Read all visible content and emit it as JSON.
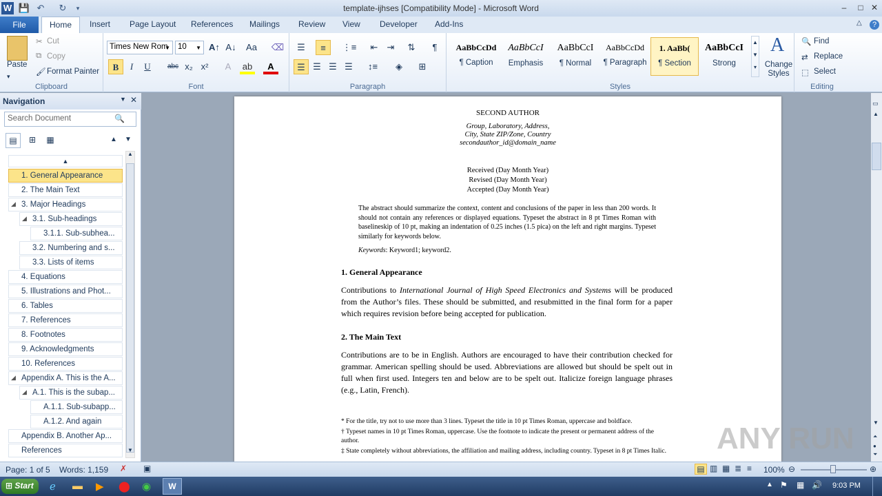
{
  "window": {
    "title": "template-ijhses [Compatibility Mode]  -  Microsoft Word",
    "minimize": "–",
    "maximize": "□",
    "close": "✕"
  },
  "tabs": [
    "File",
    "Home",
    "Insert",
    "Page Layout",
    "References",
    "Mailings",
    "Review",
    "View",
    "Developer",
    "Add-Ins"
  ],
  "ribbon": {
    "clipboard": {
      "paste": "Paste",
      "cut": "Cut",
      "copy": "Copy",
      "format_painter": "Format Painter",
      "label": "Clipboard"
    },
    "font": {
      "family": "Times New Rom",
      "size": "10",
      "label": "Font",
      "bold": "B",
      "italic": "I",
      "underline": "U",
      "strike": "abc",
      "sub": "x₂",
      "sup": "x²"
    },
    "paragraph": {
      "label": "Paragraph"
    },
    "styles": {
      "label": "Styles",
      "items": [
        {
          "preview": "AaBbCcDd",
          "name": "¶ Caption"
        },
        {
          "preview": "AaBbCcI",
          "name": "Emphasis"
        },
        {
          "preview": "AaBbCcI",
          "name": "¶ Normal"
        },
        {
          "preview": "AaBbCcDd",
          "name": "¶ Paragraph"
        },
        {
          "preview": "1.  AaBb(",
          "name": "¶ Section"
        },
        {
          "preview": "AaBbCcI",
          "name": "Strong"
        }
      ],
      "change_styles": "Change Styles"
    },
    "editing": {
      "label": "Editing",
      "find": "Find",
      "replace": "Replace",
      "select": "Select"
    }
  },
  "nav": {
    "title": "Navigation",
    "search_placeholder": "Search Document",
    "items": [
      {
        "label": "1.     General Appearance",
        "indent": 0,
        "selected": true
      },
      {
        "label": "2.     The Main Text",
        "indent": 0
      },
      {
        "label": "3.     Major Headings",
        "indent": 0,
        "tri": true
      },
      {
        "label": "3.1.     Sub-headings",
        "indent": 1,
        "tri": true
      },
      {
        "label": "3.1.1.     Sub-subhea...",
        "indent": 2
      },
      {
        "label": "3.2.     Numbering and s...",
        "indent": 1
      },
      {
        "label": "3.3.     Lists of items",
        "indent": 1
      },
      {
        "label": "4.     Equations",
        "indent": 0
      },
      {
        "label": "5.     Illustrations and Phot...",
        "indent": 0
      },
      {
        "label": "6.     Tables",
        "indent": 0
      },
      {
        "label": "7.     References",
        "indent": 0
      },
      {
        "label": "8.     Footnotes",
        "indent": 0
      },
      {
        "label": "9.     Acknowledgments",
        "indent": 0
      },
      {
        "label": "10.     References",
        "indent": 0
      },
      {
        "label": "Appendix A.    This is the A...",
        "indent": 0,
        "tri": true
      },
      {
        "label": "A.1.     This is the subap...",
        "indent": 1,
        "tri": true
      },
      {
        "label": "A.1.1.     Sub-subapp...",
        "indent": 2
      },
      {
        "label": "A.1.2.     And again",
        "indent": 2
      },
      {
        "label": "Appendix B.    Another Ap...",
        "indent": 0
      },
      {
        "label": "References",
        "indent": 0
      }
    ]
  },
  "doc": {
    "author": "SECOND AUTHOR",
    "affil": [
      "Group, Laboratory, Address,",
      "City, State ZIP/Zone, Country",
      "secondauthor_id@domain_name"
    ],
    "dates": [
      "Received (Day Month Year)",
      "Revised (Day Month Year)",
      "Accepted (Day Month Year)"
    ],
    "abstract": "The abstract should summarize the context, content and conclusions of the paper in less than 200 words. It should not contain any references or displayed equations. Typeset the abstract in 8 pt Times Roman with baselineskip of 10 pt, making an indentation of 0.25 inches (1.5 pica) on the left and right margins. Typeset similarly for keywords below.",
    "keywords_label": "Keywords",
    "keywords": ": Keyword1; keyword2.",
    "h1": "1.   General Appearance",
    "p1_a": "Contributions to ",
    "p1_i": "International Journal of High Speed Electronics and Systems",
    "p1_b": " will be produced from the Author’s files. These should be submitted, and resubmitted in the final form for a paper which requires revision before being accepted for publication.",
    "h2": "2.   The Main Text",
    "p2": "Contributions are to be in English. Authors are encouraged to have their contribution checked for grammar. American spelling should be used. Abbreviations are allowed but should be spelt out in full when first used. Integers ten and below are to be spelt out. Italicize foreign language phrases (e.g., Latin, French).",
    "fn1": "* For the title, try not to use more than 3 lines. Typeset the title in 10 pt Times Roman, uppercase and boldface.",
    "fn2": "† Typeset names in 10 pt Times Roman, uppercase. Use the footnote to indicate the present or permanent address of the author.",
    "fn3": "‡ State completely without abbreviations, the affiliation and mailing address, including country. Typeset in 8 pt Times Italic."
  },
  "status": {
    "page": "Page: 1 of 5",
    "words": "Words: 1,159",
    "zoom": "100%"
  },
  "taskbar": {
    "start": "Start",
    "time": "9:03 PM"
  },
  "watermark": "ANY RUN"
}
